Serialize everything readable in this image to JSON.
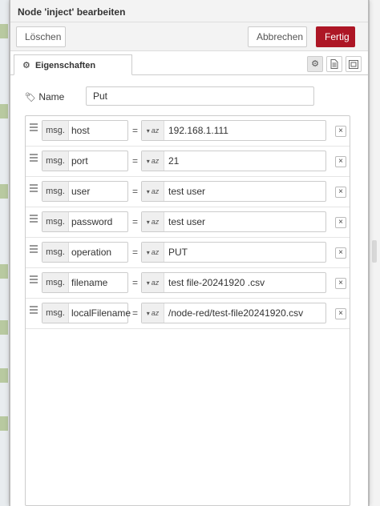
{
  "header": {
    "title": "Node 'inject' bearbeiten"
  },
  "toolbar": {
    "delete_label": "Löschen",
    "cancel_label": "Abbrechen",
    "done_label": "Fertig",
    "done_color": "#ad1625"
  },
  "tabs": {
    "properties_label": "Eigenschaften",
    "icons": [
      "gear-icon",
      "description-icon",
      "appearance-icon"
    ]
  },
  "name": {
    "label": "Name",
    "value": "Put"
  },
  "properties": [
    {
      "prefix": "msg.",
      "key": "host",
      "equals": "=",
      "type_caret": "▾",
      "type": "az",
      "value": "192.168.1.111",
      "delete": "×"
    },
    {
      "prefix": "msg.",
      "key": "port",
      "equals": "=",
      "type_caret": "▾",
      "type": "az",
      "value": "21",
      "delete": "×"
    },
    {
      "prefix": "msg.",
      "key": "user",
      "equals": "=",
      "type_caret": "▾",
      "type": "az",
      "value": "test user",
      "delete": "×"
    },
    {
      "prefix": "msg.",
      "key": "password",
      "equals": "=",
      "type_caret": "▾",
      "type": "az",
      "value": "test user",
      "delete": "×"
    },
    {
      "prefix": "msg.",
      "key": "operation",
      "equals": "=",
      "type_caret": "▾",
      "type": "az",
      "value": "PUT",
      "delete": "×"
    },
    {
      "prefix": "msg.",
      "key": "filename",
      "equals": "=",
      "type_caret": "▾",
      "type": "az",
      "value": "test file-20241920 .csv",
      "delete": "×"
    },
    {
      "prefix": "msg.",
      "key": "localFilename",
      "equals": "=",
      "type_caret": "▾",
      "type": "az",
      "value": "/node-red/test-file20241920.csv",
      "delete": "×"
    }
  ]
}
